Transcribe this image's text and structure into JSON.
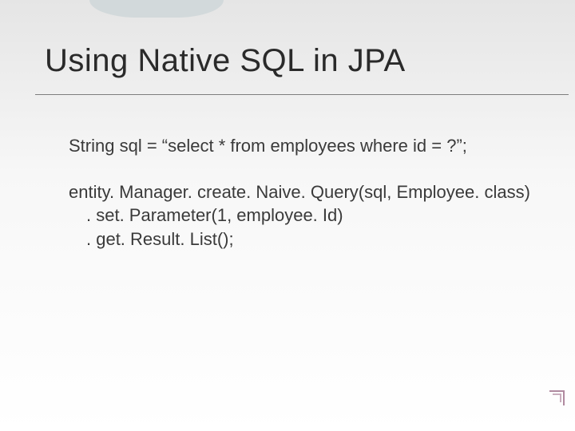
{
  "slide": {
    "title": "Using Native SQL in JPA",
    "line1": "String sql = “select * from employees where id = ?”;",
    "code1": "entity. Manager. create. Naive. Query(sql, Employee. class)",
    "code2": ". set. Parameter(1, employee. Id)",
    "code3": ". get. Result. List();"
  }
}
